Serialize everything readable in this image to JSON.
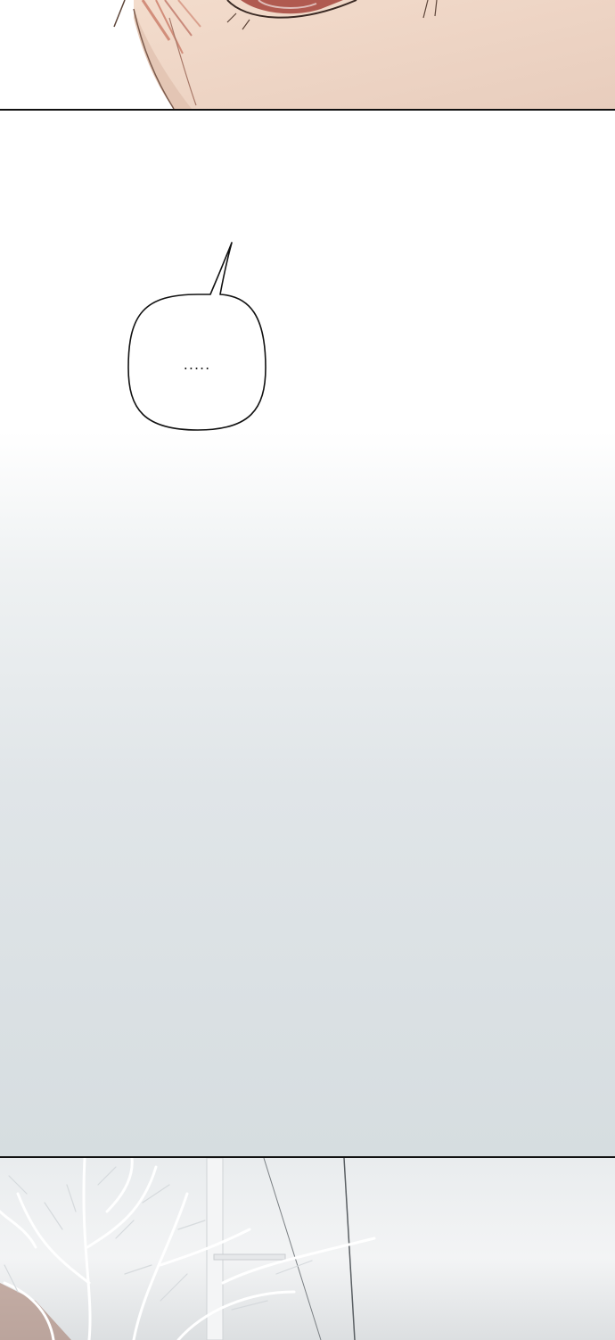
{
  "speech_bubble": {
    "text": "....."
  },
  "colors": {
    "panel_border": "#111111",
    "skin": "#f2d9c8",
    "hair": "#c97a66",
    "sky": "#e9ecee",
    "tree": "#ffffff"
  }
}
